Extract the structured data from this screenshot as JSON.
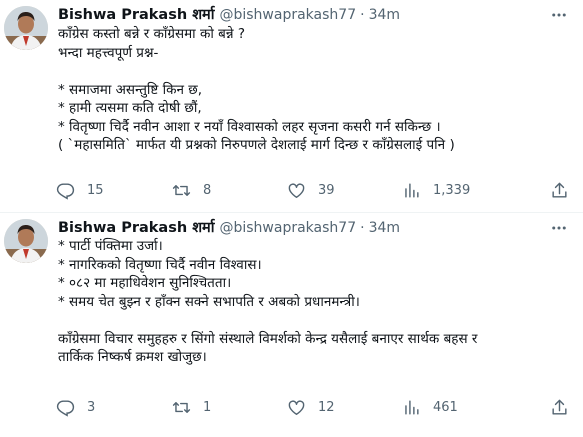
{
  "tweets": [
    {
      "display_name": "Bishwa Prakash शर्मा",
      "handle": "@bishwaprakash77",
      "separator": "·",
      "time": "34m",
      "lines": [
        "काँग्रेस कस्तो बन्ने र काँग्रेसमा को बन्ने ?",
        "भन्दा महत्त्वपूर्ण प्रश्न-",
        "",
        "* समाजमा असन्तुष्टि किन छ,",
        "* हामी त्यसमा कति दोषी छौं,",
        "* वितृष्णा चिर्दै नवीन आशा र नयाँ विश्वासको लहर सृजना कसरी गर्न सकिन्छ ।",
        "( `महासमिति` मार्फत यी प्रश्नको निरुपणले देशलाई मार्ग दिन्छ र काँग्रेसलाई पनि )"
      ],
      "replies": "15",
      "retweets": "8",
      "likes": "39",
      "views": "1,339"
    },
    {
      "display_name": "Bishwa Prakash शर्मा",
      "handle": "@bishwaprakash77",
      "separator": "·",
      "time": "34m",
      "lines": [
        "* पार्टी पंक्तिमा उर्जा।",
        "* नागरिकको वितृष्णा चिर्दै नवीन विश्वास।",
        "* ०८२ मा महाधिवेशन सुनिश्चितता।",
        "* समय चेत बुझ्न र हाँक्न सक्ने सभापति र अबको प्रधानमन्त्री।",
        "",
        "काँग्रेसमा विचार समुहहरु र सिंगो संस्थाले विमर्शको केन्द्र यसैलाई बनाएर सार्थक बहस र",
        "तार्किक निष्कर्ष क्रमश खोजुछ।"
      ],
      "replies": "3",
      "retweets": "1",
      "likes": "12",
      "views": "461"
    }
  ],
  "icons": {
    "more": "more-horizontal-icon",
    "reply": "reply-icon",
    "retweet": "retweet-icon",
    "like": "heart-icon",
    "views": "views-chart-icon",
    "share": "share-icon"
  },
  "colors": {
    "text": "#0f1419",
    "secondary": "#536471",
    "divider": "#eff3f4"
  }
}
